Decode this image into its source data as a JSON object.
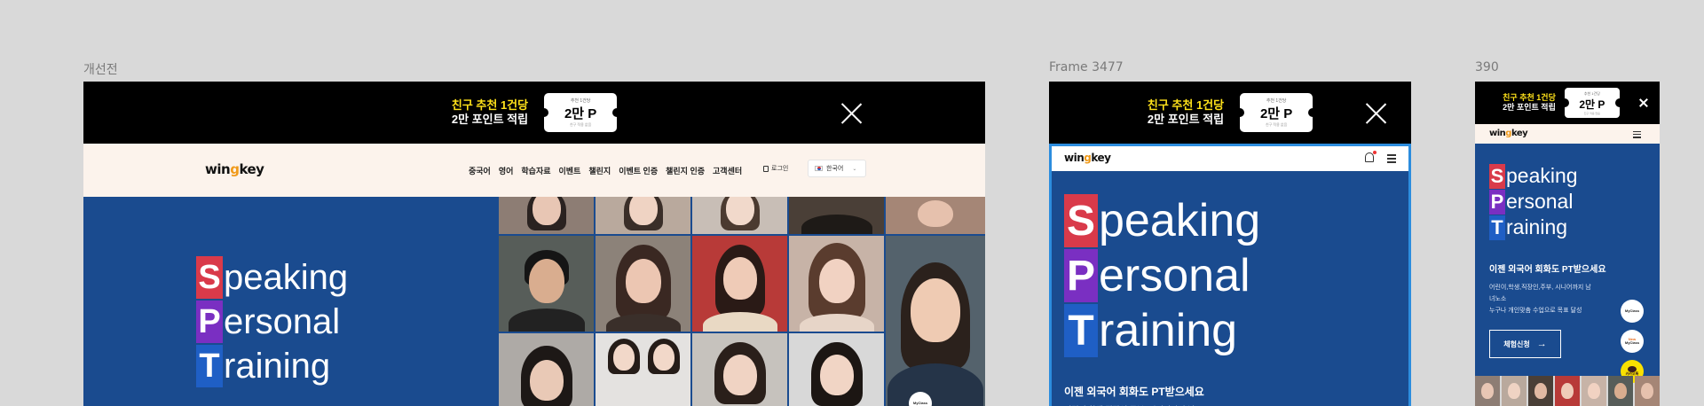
{
  "labels": {
    "frame1": "개선전",
    "frame2": "Frame 3477",
    "frame3": "390"
  },
  "banner": {
    "line1": "친구 추천 1건당",
    "line2": "2만 포인트 적립",
    "ticket_top": "추천 1건당",
    "ticket_main": "2만 P",
    "ticket_foot": "친구 적용 없음"
  },
  "header": {
    "logo_pre": "win",
    "logo_o": "g",
    "logo_post": "key",
    "nav": [
      "중국어",
      "영어",
      "학습자료",
      "이벤트",
      "챌린지",
      "이벤트 인증",
      "챌린지 인증",
      "고객센터"
    ],
    "login": "로그인",
    "language": "한국어"
  },
  "hero": {
    "s": "S",
    "s_rest": "peaking",
    "p": "P",
    "p_rest": "ersonal",
    "t": "T",
    "t_rest": "raining",
    "subheading": "이젠 외국어 회화도 PT받으세요",
    "desc1": "어린이,학생,직장인,주부, 시니어까지 남",
    "desc2": "녀노소",
    "desc3": "누구나 개인맞춤 수업으로 목표 달성",
    "cta": "체험신청"
  },
  "fab": {
    "myclass": "MyClass",
    "new": "New",
    "kakao": "카카오톡"
  },
  "colors": {
    "hero": "#1a4b8f",
    "header_bg": "#fcf3ec",
    "accent_red": "#d93a4a",
    "accent_purple": "#7a2fc2",
    "accent_blue": "#1f5fc5",
    "banner_yellow": "#ffe21a"
  }
}
